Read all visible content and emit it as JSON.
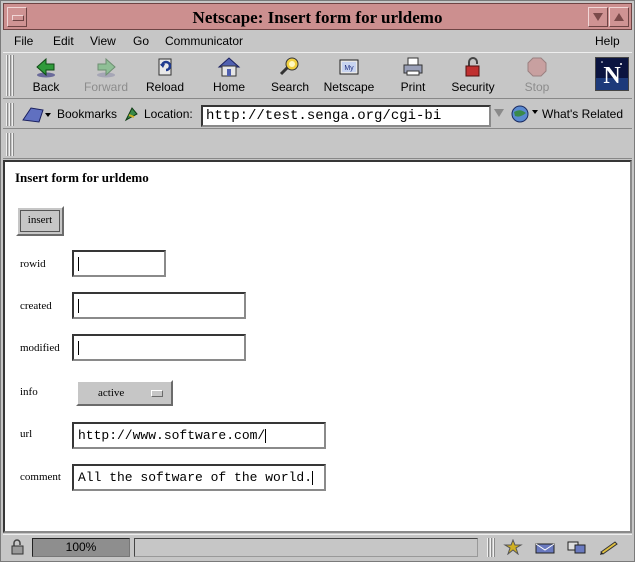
{
  "window": {
    "title": "Netscape: Insert form for urldemo"
  },
  "menubar": {
    "items": [
      "File",
      "Edit",
      "View",
      "Go",
      "Communicator",
      "Help"
    ]
  },
  "toolbar": {
    "buttons": [
      {
        "label": "Back",
        "icon": "back-arrow-icon",
        "enabled": true
      },
      {
        "label": "Forward",
        "icon": "forward-arrow-icon",
        "enabled": false
      },
      {
        "label": "Reload",
        "icon": "reload-icon",
        "enabled": true
      },
      {
        "label": "Home",
        "icon": "home-icon",
        "enabled": true
      },
      {
        "label": "Search",
        "icon": "search-icon",
        "enabled": true
      },
      {
        "label": "Netscape",
        "icon": "netscape-icon",
        "enabled": true
      },
      {
        "label": "Print",
        "icon": "print-icon",
        "enabled": true
      },
      {
        "label": "Security",
        "icon": "security-lock-icon",
        "enabled": true
      },
      {
        "label": "Stop",
        "icon": "stop-icon",
        "enabled": false
      }
    ],
    "logo_letter": "N"
  },
  "location_bar": {
    "bookmarks_label": "Bookmarks",
    "location_label": "Location:",
    "url": "http://test.senga.org/cgi-bi",
    "whats_related_label": "What's Related"
  },
  "page": {
    "title": "Insert form for urldemo",
    "insert_button": "insert",
    "fields": {
      "rowid": {
        "label": "rowid",
        "value": ""
      },
      "created": {
        "label": "created",
        "value": ""
      },
      "modified": {
        "label": "modified",
        "value": ""
      },
      "info": {
        "label": "info",
        "value": "active"
      },
      "url": {
        "label": "url",
        "value": "http://www.software.com/"
      },
      "comment": {
        "label": "comment",
        "value": "All the software of the world."
      }
    }
  },
  "statusbar": {
    "zoom": "100%"
  },
  "colors": {
    "titlebar": "#cc8f8f",
    "chrome": "#c6c6c6",
    "content": "#ffffff"
  }
}
